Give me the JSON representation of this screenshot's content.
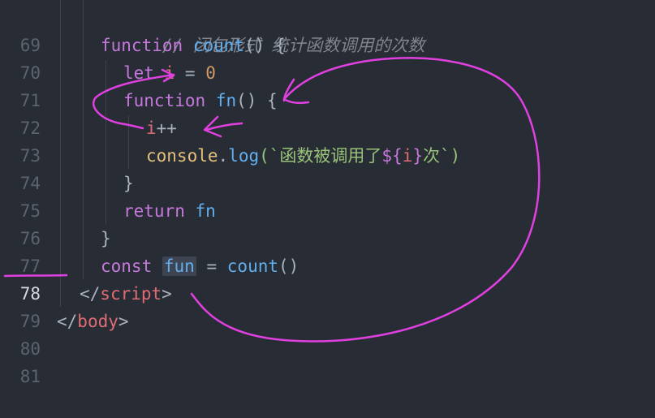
{
  "colors": {
    "background": "#282c34",
    "annotation_ink": "#e040e0"
  },
  "editor": {
    "active_line": "78",
    "lines": [
      {
        "num": "69",
        "tokens": [
          "// 闭包形式 统计函数调用的次数"
        ]
      },
      {
        "num": "70",
        "tokens": [
          "function",
          "count",
          "() {"
        ]
      },
      {
        "num": "71",
        "tokens": [
          "let",
          "i",
          "=",
          "0"
        ]
      },
      {
        "num": "72",
        "tokens": [
          "function",
          "fn",
          "() {"
        ]
      },
      {
        "num": "73",
        "tokens": [
          "i",
          "++"
        ]
      },
      {
        "num": "74",
        "tokens": [
          "console",
          ".",
          "log",
          "(`函数被调用了",
          "${",
          "i",
          "}",
          "次`)"
        ]
      },
      {
        "num": "75",
        "tokens": [
          "}"
        ]
      },
      {
        "num": "76",
        "tokens": [
          "return",
          "fn"
        ]
      },
      {
        "num": "77",
        "tokens": [
          "}"
        ]
      },
      {
        "num": "78",
        "tokens": [
          "const",
          "fun",
          "=",
          "count",
          "()"
        ]
      },
      {
        "num": "79",
        "tokens": [
          "</",
          "script",
          ">"
        ]
      },
      {
        "num": "80",
        "tokens": [
          "</",
          "body",
          ">"
        ]
      },
      {
        "num": "81",
        "tokens": []
      }
    ]
  }
}
